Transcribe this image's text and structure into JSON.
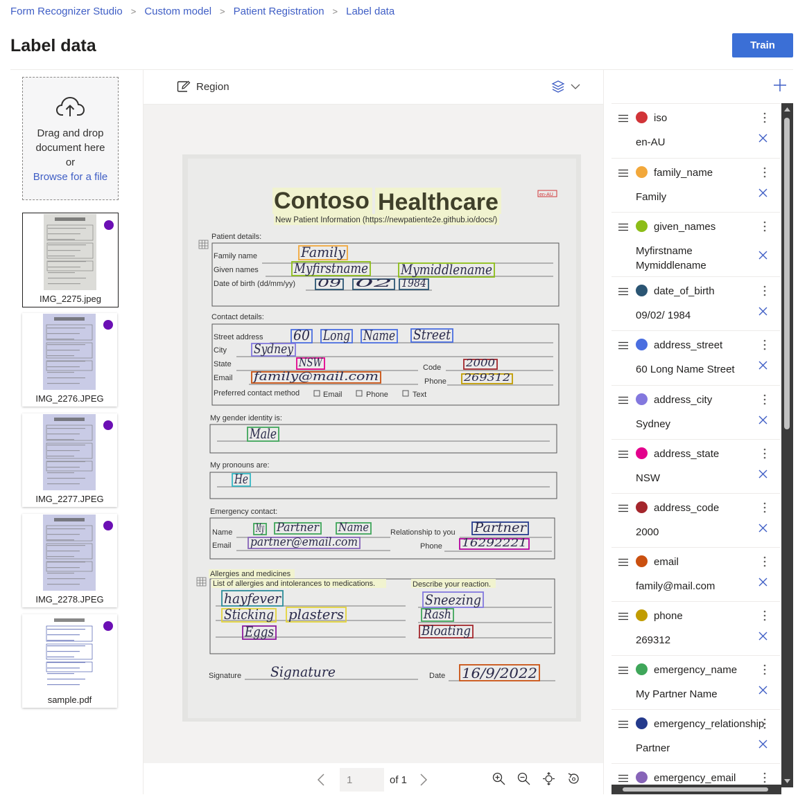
{
  "breadcrumb": [
    "Form Recognizer Studio",
    "Custom model",
    "Patient Registration",
    "Label data"
  ],
  "page_title": "Label data",
  "train_label": "Train",
  "dropzone": {
    "line1": "Drag and drop",
    "line2": "document here",
    "line3": "or",
    "browse": "Browse for a file"
  },
  "files": [
    {
      "name": "IMG_2275.jpeg",
      "selected": true,
      "status_color": "#6b0fb4"
    },
    {
      "name": "IMG_2276.JPEG",
      "selected": false,
      "status_color": "#6b0fb4"
    },
    {
      "name": "IMG_2277.JPEG",
      "selected": false,
      "status_color": "#6b0fb4"
    },
    {
      "name": "IMG_2278.JPEG",
      "selected": false,
      "status_color": "#6b0fb4"
    },
    {
      "name": "sample.pdf",
      "selected": false,
      "status_color": "#6b0fb4"
    }
  ],
  "toolbar": {
    "region_label": "Region"
  },
  "pager": {
    "current": "1",
    "of_label": "of 1"
  },
  "document": {
    "title_a": "Contoso",
    "title_b": "Healthcare",
    "subtitle": "New Patient Information (https://newpatiente2e.github.io/docs/)",
    "iso_stamp": "en-AU",
    "sections": {
      "patient": "Patient details:",
      "family_name_lbl": "Family name",
      "given_names_lbl": "Given names",
      "dob_lbl": "Date of birth (dd/mm/yy)",
      "contact": "Contact details:",
      "street_lbl": "Street address",
      "city_lbl": "City",
      "state_lbl": "State",
      "email_lbl": "Email",
      "code_lbl": "Code",
      "phone_lbl": "Phone",
      "pref_lbl": "Preferred contact method",
      "pref_email": "Email",
      "pref_phone": "Phone",
      "pref_text": "Text",
      "gender": "My gender identity is:",
      "pronouns": "My pronouns are:",
      "emergency": "Emergency contact:",
      "em_name_lbl": "Name",
      "em_rel_lbl": "Relationship to you",
      "em_email_lbl": "Email",
      "em_phone_lbl": "Phone",
      "allergies": "Allergies and medicines",
      "allergy_list_lbl": "List of allergies and intolerances to medications.",
      "reaction_lbl": "Describe your reaction.",
      "signature_lbl": "Signature",
      "date_lbl": "Date"
    },
    "handwriting": {
      "family": "Family",
      "first": "Myfirstname",
      "middle": "Mymiddlename",
      "dob_d": "09",
      "dob_m": "02",
      "dob_y": "1984",
      "street": [
        "60",
        "Long",
        "Name",
        "Street"
      ],
      "city": "Sydney",
      "state": "NSW",
      "code": "2000",
      "email": "family@mail.com",
      "phone": "269312",
      "gender": "Male",
      "pronoun": "He",
      "em_name": [
        "My",
        "Partner",
        "Name"
      ],
      "em_rel": "Partner",
      "em_email": "partner@email.com",
      "em_phone": "16292221",
      "allergy1": "hayfever",
      "allergy2a": "Sticking",
      "allergy2b": "plasters",
      "allergy3": "Eggs",
      "react1": "Sneezing",
      "react2": "Rash",
      "react3": "Bloating",
      "signature": "Signature",
      "date": "16/9/2022"
    }
  },
  "fields": [
    {
      "name": "iso",
      "value": "en-AU",
      "color": "#d13438"
    },
    {
      "name": "family_name",
      "value": "Family",
      "color": "#f2a83b"
    },
    {
      "name": "given_names",
      "value": "Myfirstname\nMymiddlename",
      "color": "#8cbd18"
    },
    {
      "name": "date_of_birth",
      "value": "09/02/ 1984",
      "color": "#2b5573"
    },
    {
      "name": "address_street",
      "value": "60 Long Name Street",
      "color": "#4a6ee0"
    },
    {
      "name": "address_city",
      "value": "Sydney",
      "color": "#8378de"
    },
    {
      "name": "address_state",
      "value": "NSW",
      "color": "#e3008c"
    },
    {
      "name": "address_code",
      "value": "2000",
      "color": "#a4262c"
    },
    {
      "name": "email",
      "value": "family@mail.com",
      "color": "#ca5010"
    },
    {
      "name": "phone",
      "value": "269312",
      "color": "#c19c00"
    },
    {
      "name": "emergency_name",
      "value": "My Partner Name",
      "color": "#3fa65a"
    },
    {
      "name": "emergency_relationship",
      "value": "Partner",
      "color": "#243a8c"
    },
    {
      "name": "emergency_email",
      "value": "",
      "color": "#8764b8"
    }
  ]
}
